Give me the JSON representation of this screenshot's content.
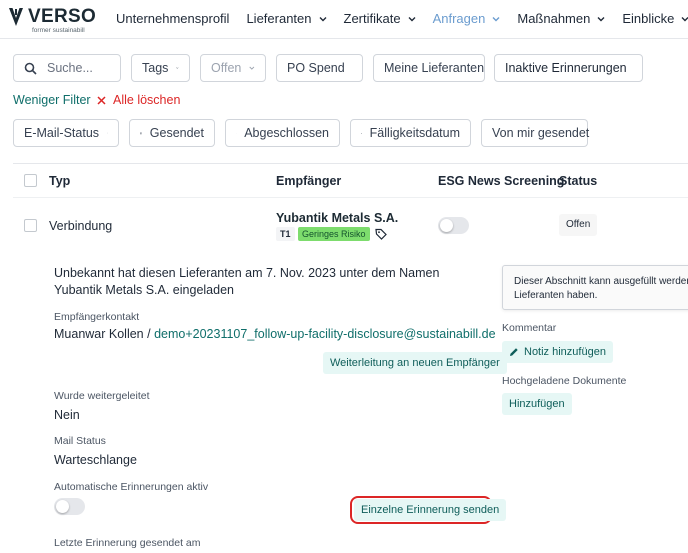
{
  "brand": {
    "name": "VERSO",
    "tagline": "former sustainabill"
  },
  "nav": {
    "items": [
      {
        "label": "Unternehmensprofil",
        "dropdown": false,
        "active": false
      },
      {
        "label": "Lieferanten",
        "dropdown": true,
        "active": false
      },
      {
        "label": "Zertifikate",
        "dropdown": true,
        "active": false
      },
      {
        "label": "Anfragen",
        "dropdown": true,
        "active": true
      },
      {
        "label": "Maßnahmen",
        "dropdown": true,
        "active": false
      },
      {
        "label": "Einblicke",
        "dropdown": true,
        "active": false
      }
    ]
  },
  "filters": {
    "search_placeholder": "Suche...",
    "tags": "Tags",
    "status": "Offen",
    "po_spend": "PO Spend",
    "my_suppliers": "Meine Lieferanten",
    "inactive_reminders": "Inaktive Erinnerungen",
    "less_filter": "Weniger Filter",
    "clear_all": "Alle löschen",
    "email_status": "E-Mail-Status",
    "sent": "Gesendet",
    "completed": "Abgeschlossen",
    "due_date": "Fälligkeitsdatum",
    "sent_by_me": "Von mir gesendet"
  },
  "table": {
    "headers": {
      "type": "Typ",
      "recipient": "Empfänger",
      "esg": "ESG News Screening",
      "status": "Status"
    },
    "row": {
      "type": "Verbindung",
      "supplier": "Yubantik Metals S.A.",
      "tier": "T1",
      "risk": "Geringes Risiko",
      "status": "Offen"
    }
  },
  "detail": {
    "invite_text": "Unbekannt hat diesen Lieferanten am 7. Nov. 2023 unter dem Namen Yubantik Metals S.A. eingeladen",
    "contact_label": "Empfängerkontakt",
    "contact_name": "Muanwar Kollen / ",
    "contact_email": "demo+20231107_follow-up-facility-disclosure@sustainabill.de",
    "forward_button": "Weiterleitung an neuen Empfänger",
    "forwarded_label": "Wurde weitergeleitet",
    "forwarded_value": "Nein",
    "mail_status_label": "Mail Status",
    "mail_status_value": "Warteschlange",
    "auto_reminders_label": "Automatische Erinnerungen aktiv",
    "send_reminder_button": "Einzelne Erinnerung senden",
    "last_reminder_label": "Letzte Erinnerung gesendet am",
    "note_box_line1": "Dieser Abschnitt kann ausgefüllt werden",
    "note_box_line2": "Lieferanten haben.",
    "comment_label": "Kommentar",
    "add_note_button": "Notiz hinzufügen",
    "uploaded_docs_label": "Hochgeladene Dokumente",
    "add_button": "Hinzufügen"
  },
  "colors": {
    "teal_text": "#0f6e6a",
    "nav_active": "#6b9ccf",
    "danger": "#dc2626",
    "risk_green": "#7ddc6d",
    "teal_button_bg": "#e6f7f5"
  }
}
